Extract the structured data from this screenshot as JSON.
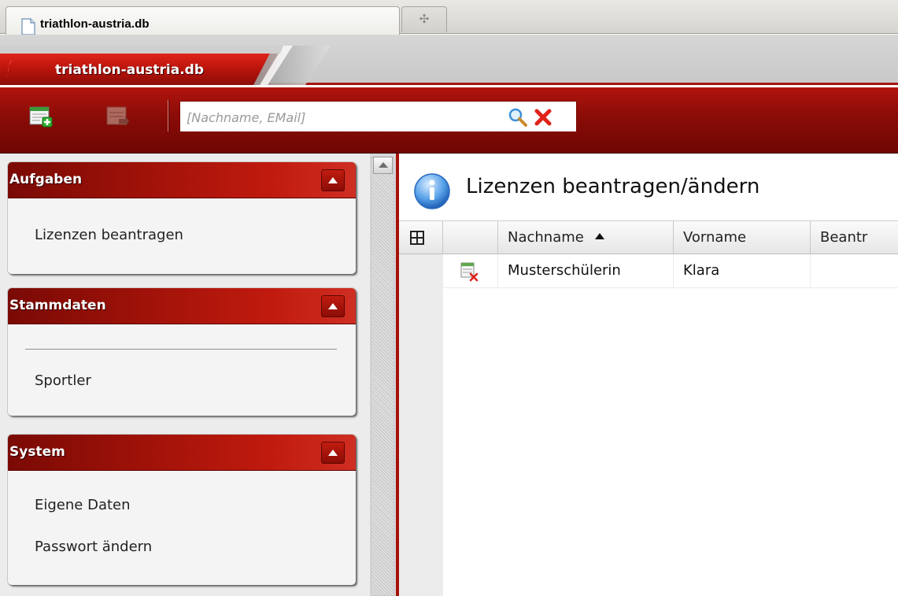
{
  "browser": {
    "tab_title": "triathlon-austria.db",
    "new_tab_glyph": "✣"
  },
  "header": {
    "app_title": "triathlon-austria.db"
  },
  "toolbar": {
    "search": {
      "placeholder": "[Nachname, EMail]",
      "value": ""
    }
  },
  "sidebar": {
    "panels": [
      {
        "title": "Aufgaben",
        "items": [
          "Lizenzen beantragen"
        ]
      },
      {
        "title": "Stammdaten",
        "items": [
          "Sportler"
        ]
      },
      {
        "title": "System",
        "items": [
          "Eigene Daten",
          "Passwort ändern"
        ]
      }
    ]
  },
  "main": {
    "title": "Lizenzen beantragen/ändern",
    "columns": [
      "Nachname",
      "Vorname",
      "Beantr"
    ],
    "sort": {
      "column": "Nachname",
      "direction": "ascending"
    },
    "rows": [
      {
        "nachname": "Musterschülerin",
        "vorname": "Klara",
        "beantr": ""
      }
    ]
  },
  "colors": {
    "brand_red": "#a41510",
    "toolbar_dark_red": "#6f0703",
    "panel_header_red": "#c01a0e"
  },
  "icons": {
    "tab": "document-icon",
    "toolbar_new": "add-record-icon",
    "toolbar_export": "export-record-icon",
    "search": "search-icon",
    "clear": "clear-search-icon",
    "main": "info-icon",
    "grid_columns": "column-picker-icon",
    "row": "delete-row-icon"
  }
}
